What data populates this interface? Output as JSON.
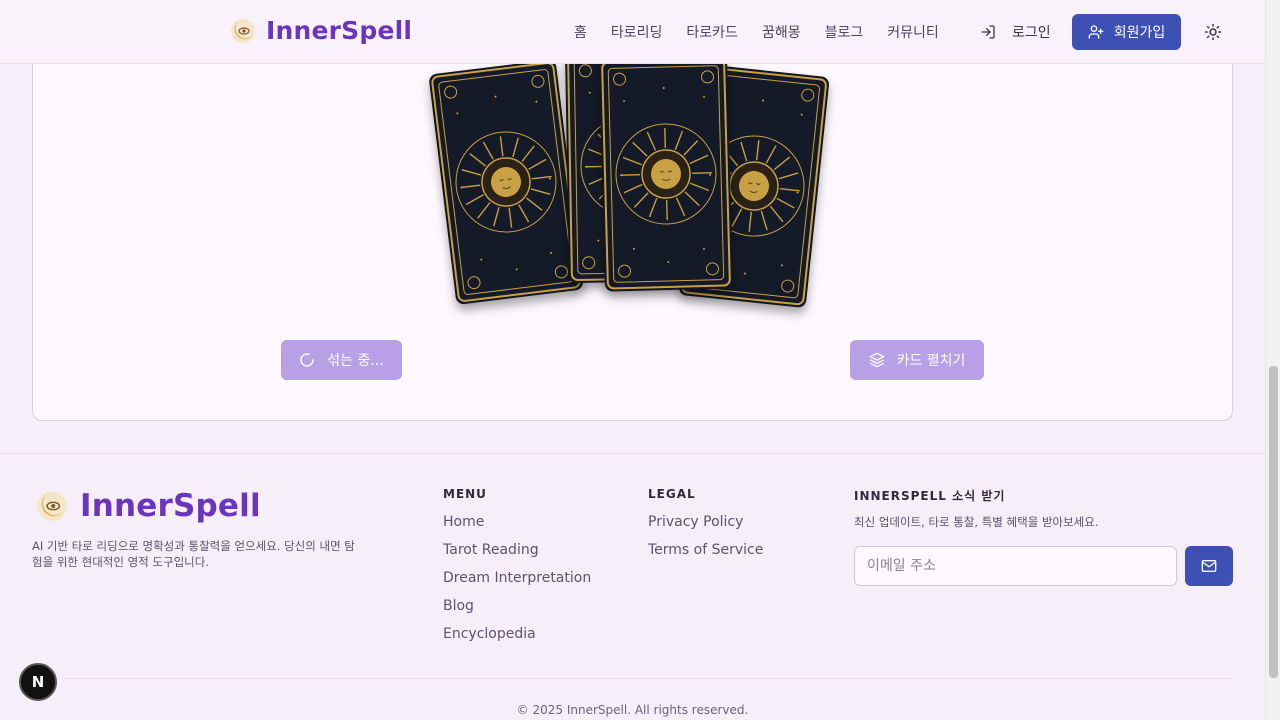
{
  "header": {
    "brand": "InnerSpell",
    "nav": [
      "홈",
      "타로리딩",
      "타로카드",
      "꿈해몽",
      "블로그",
      "커뮤니티"
    ],
    "login_label": "로그인",
    "signup_label": "회원가입"
  },
  "reading": {
    "shuffle_label": "섞는 중...",
    "spread_label": "카드 펼치기"
  },
  "footer": {
    "brand": "InnerSpell",
    "description": "AI 기반 타로 리딩으로 명확성과 통찰력을 얻으세요. 당신의 내면 탐험을 위한 현대적인 영적 도구입니다.",
    "menu_title": "MENU",
    "menu_items": [
      "Home",
      "Tarot Reading",
      "Dream Interpretation",
      "Blog",
      "Encyclopedia"
    ],
    "legal_title": "LEGAL",
    "legal_items": [
      "Privacy Policy",
      "Terms of Service"
    ],
    "news_title": "INNERSPELL 소식 받기",
    "news_desc": "최신 업데이트, 타로 통찰, 특별 혜택을 받아보세요.",
    "email_placeholder": "이메일 주소",
    "copyright": "© 2025 InnerSpell. All rights reserved."
  },
  "badge": "N",
  "colors": {
    "brand": "#6b35c0",
    "primary_button": "#3f50b5",
    "disabled_button": "#b9a0e6",
    "card_gold": "#c9a043"
  }
}
